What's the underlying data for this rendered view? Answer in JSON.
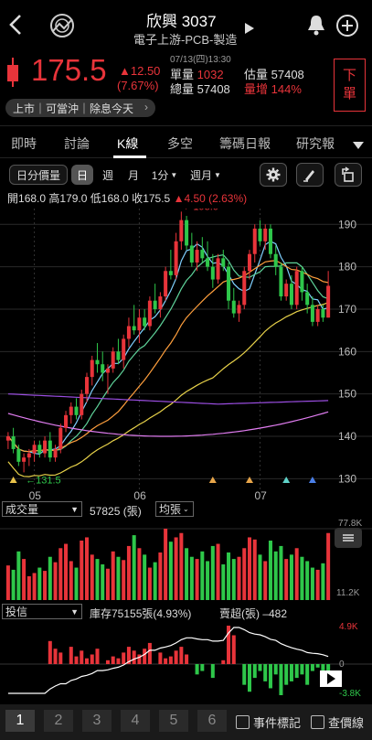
{
  "header": {
    "title": "欣興 3037",
    "subtitle": "電子上游-PCB-製造",
    "datetime": "07/13(四)13:30"
  },
  "quote": {
    "price": "175.5",
    "change": "▲12.50",
    "change_pct": "(7.67%)",
    "lot_vol_label": "單量",
    "lot_vol": "1032",
    "total_vol_label": "總量",
    "total_vol": "57408",
    "est_vol_label": "估量",
    "est_vol": "57408",
    "vol_inc_label": "量增",
    "vol_inc": "144%",
    "order_button": "下\n單"
  },
  "badges": "上市｜可當沖｜除息今天",
  "tabs": [
    "即時",
    "討論",
    "K線",
    "多空",
    "籌碼日報",
    "研究報告"
  ],
  "active_tab": 2,
  "toolbar": {
    "daily_vol": "日分價量",
    "day": "日",
    "week": "週",
    "month": "月",
    "minute": "1分",
    "period": "週月"
  },
  "ohlc": {
    "open_label": "開",
    "open": "168.0",
    "high_label": "高",
    "high": "179.0",
    "low_label": "低",
    "low": "168.0",
    "close_label": "收",
    "close": "175.5",
    "chg": "▲4.50 (2.63%)"
  },
  "chart_data": [
    {
      "type": "candlestick",
      "yticks": [
        130,
        140,
        150,
        160,
        170,
        180,
        190
      ],
      "ylim": [
        129,
        192
      ],
      "xlabels": [
        "05",
        "06",
        "07"
      ],
      "annotations": {
        "high": "193.0",
        "low": "131.5"
      },
      "candles": [
        [
          139,
          141,
          137,
          140
        ],
        [
          140,
          142,
          136,
          137
        ],
        [
          137,
          138,
          133,
          134
        ],
        [
          134,
          136,
          131.5,
          135
        ],
        [
          135,
          137,
          133,
          136
        ],
        [
          136,
          139,
          134,
          138
        ],
        [
          138,
          139,
          135,
          136
        ],
        [
          136,
          140,
          135,
          139
        ],
        [
          139,
          141,
          134,
          135
        ],
        [
          135,
          138,
          134,
          137
        ],
        [
          137,
          143,
          136,
          142
        ],
        [
          142,
          146,
          141,
          145
        ],
        [
          145,
          148,
          143,
          147
        ],
        [
          147,
          149,
          144,
          145
        ],
        [
          145,
          151,
          144,
          150
        ],
        [
          150,
          155,
          148,
          154
        ],
        [
          154,
          159,
          152,
          158
        ],
        [
          158,
          162,
          155,
          157
        ],
        [
          157,
          160,
          153,
          155
        ],
        [
          155,
          157,
          150,
          156
        ],
        [
          156,
          161,
          155,
          160
        ],
        [
          160,
          163,
          157,
          158
        ],
        [
          158,
          164,
          156,
          163
        ],
        [
          163,
          168,
          161,
          166
        ],
        [
          166,
          171,
          164,
          165
        ],
        [
          165,
          170,
          162,
          168
        ],
        [
          168,
          170,
          165,
          166
        ],
        [
          166,
          173,
          165,
          172
        ],
        [
          172,
          176,
          169,
          170
        ],
        [
          170,
          174,
          168,
          173
        ],
        [
          173,
          180,
          172,
          179
        ],
        [
          179,
          184,
          177,
          178
        ],
        [
          178,
          188,
          177,
          186
        ],
        [
          186,
          193,
          184,
          191
        ],
        [
          191,
          192,
          184,
          185
        ],
        [
          185,
          188,
          180,
          181
        ],
        [
          181,
          186,
          179,
          184
        ],
        [
          184,
          187,
          181,
          182
        ],
        [
          182,
          186,
          179,
          180
        ],
        [
          180,
          183,
          175,
          177
        ],
        [
          177,
          183,
          176,
          182
        ],
        [
          182,
          184,
          179,
          180
        ],
        [
          180,
          181,
          170,
          172
        ],
        [
          172,
          175,
          168,
          169
        ],
        [
          169,
          172,
          167,
          171
        ],
        [
          171,
          180,
          170,
          179
        ],
        [
          179,
          184,
          177,
          183
        ],
        [
          183,
          190,
          181,
          189
        ],
        [
          189,
          191,
          185,
          186
        ],
        [
          186,
          190,
          184,
          189
        ],
        [
          189,
          190,
          182,
          183
        ],
        [
          183,
          185,
          178,
          180
        ],
        [
          180,
          181,
          172,
          173
        ],
        [
          173,
          177,
          172,
          176
        ],
        [
          176,
          178,
          170,
          171
        ],
        [
          171,
          180,
          170,
          179
        ],
        [
          179,
          180,
          172,
          174
        ],
        [
          174,
          176,
          169,
          171
        ],
        [
          171,
          173,
          166,
          167
        ],
        [
          167,
          171,
          166,
          170
        ],
        [
          170,
          171,
          167,
          168
        ],
        [
          168,
          179,
          168,
          175.5
        ]
      ],
      "ma_lines": [
        {
          "name": "MA5",
          "color": "#7fd0ff"
        },
        {
          "name": "MA10",
          "color": "#5fd39a"
        },
        {
          "name": "MA20",
          "color": "#ff9f3d"
        },
        {
          "name": "MA60",
          "color": "#e8d24a"
        },
        {
          "name": "MA120",
          "color": "#e07cf0"
        },
        {
          "name": "MA240",
          "color": "#9a4de0"
        }
      ]
    },
    {
      "type": "bar",
      "name": "成交量",
      "latest": "57825 (張)",
      "avg_label": "均張",
      "ymax_label": "77.8K",
      "ymin_label": "11.2K",
      "values": [
        32,
        28,
        45,
        38,
        22,
        25,
        30,
        27,
        40,
        35,
        48,
        52,
        36,
        30,
        55,
        58,
        42,
        38,
        33,
        29,
        45,
        40,
        37,
        50,
        60,
        48,
        42,
        30,
        35,
        44,
        66,
        54,
        58,
        62,
        48,
        40,
        38,
        45,
        36,
        50,
        52,
        33,
        44,
        38,
        40,
        48,
        58,
        56,
        42,
        36,
        55,
        45,
        50,
        38,
        42,
        48,
        40,
        36,
        30,
        28,
        34,
        62
      ]
    },
    {
      "type": "bar",
      "name": "投信",
      "stock_label": "庫存75155張(4.93%)",
      "net_label": "賣超(張) –482",
      "ymax_label": "4.9K",
      "zero_label": "0",
      "ymin_label": "-3.8K",
      "values": [
        0,
        0,
        0,
        0,
        0,
        0,
        0,
        0,
        1200,
        800,
        600,
        0,
        900,
        400,
        700,
        300,
        500,
        800,
        0,
        200,
        400,
        300,
        600,
        900,
        700,
        500,
        800,
        1100,
        0,
        600,
        300,
        400,
        700,
        900,
        500,
        0,
        -300,
        -200,
        0,
        -400,
        0,
        200,
        2000,
        1500,
        0,
        -600,
        -800,
        -400,
        -200,
        -500,
        -700,
        -300,
        -900,
        -600,
        -500,
        -400,
        -300,
        -600,
        -200,
        -100,
        -300,
        -482
      ]
    }
  ],
  "bottom_pages": [
    "1",
    "2",
    "3",
    "4",
    "5",
    "6"
  ],
  "bottom_checks": [
    "事件標記",
    "查價線"
  ]
}
